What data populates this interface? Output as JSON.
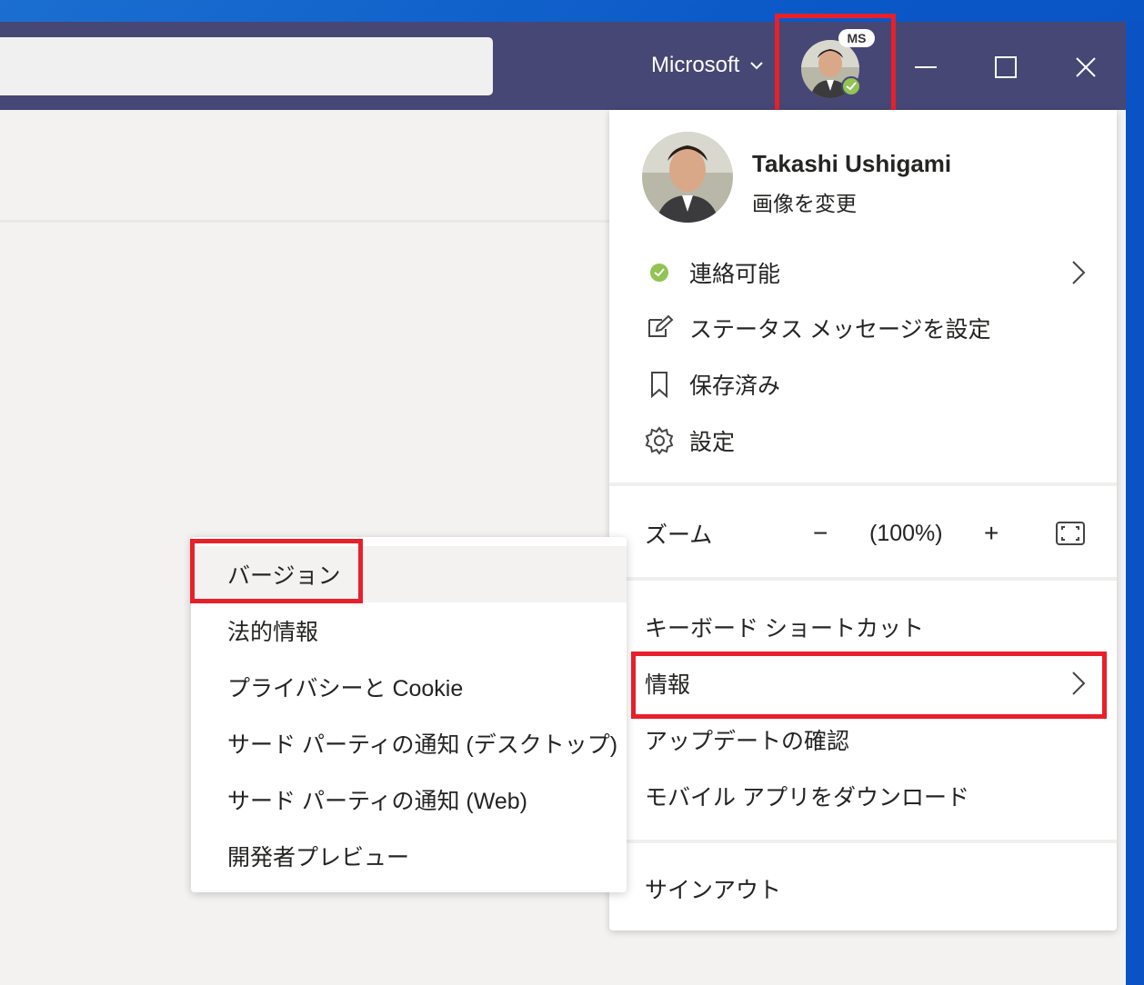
{
  "titlebar": {
    "tenant_label": "Microsoft",
    "badge": "MS"
  },
  "profile": {
    "name": "Takashi Ushigami",
    "change_picture": "画像を変更"
  },
  "menu": {
    "status": "連絡可能",
    "status_message": "ステータス メッセージを設定",
    "saved": "保存済み",
    "settings": "設定",
    "zoom_label": "ズーム",
    "zoom_minus": "−",
    "zoom_value": "(100%)",
    "zoom_plus": "+",
    "keyboard_shortcuts": "キーボード ショートカット",
    "about": "情報",
    "check_updates": "アップデートの確認",
    "download_mobile": "モバイル アプリをダウンロード",
    "sign_out": "サインアウト"
  },
  "submenu": {
    "items": [
      "バージョン",
      "法的情報",
      "プライバシーと Cookie",
      "サード パーティの通知 (デスクトップ)",
      "サード パーティの通知 (Web)",
      "開発者プレビュー"
    ]
  },
  "colors": {
    "titlebar": "#464775",
    "highlight": "#e8202a",
    "status_green": "#92c353"
  },
  "icons": [
    "chevron-down-icon",
    "minimize-icon",
    "maximize-icon",
    "close-icon",
    "status-available-icon",
    "edit-status-icon",
    "bookmark-icon",
    "gear-icon",
    "chevron-right-icon",
    "fit-screen-icon"
  ]
}
